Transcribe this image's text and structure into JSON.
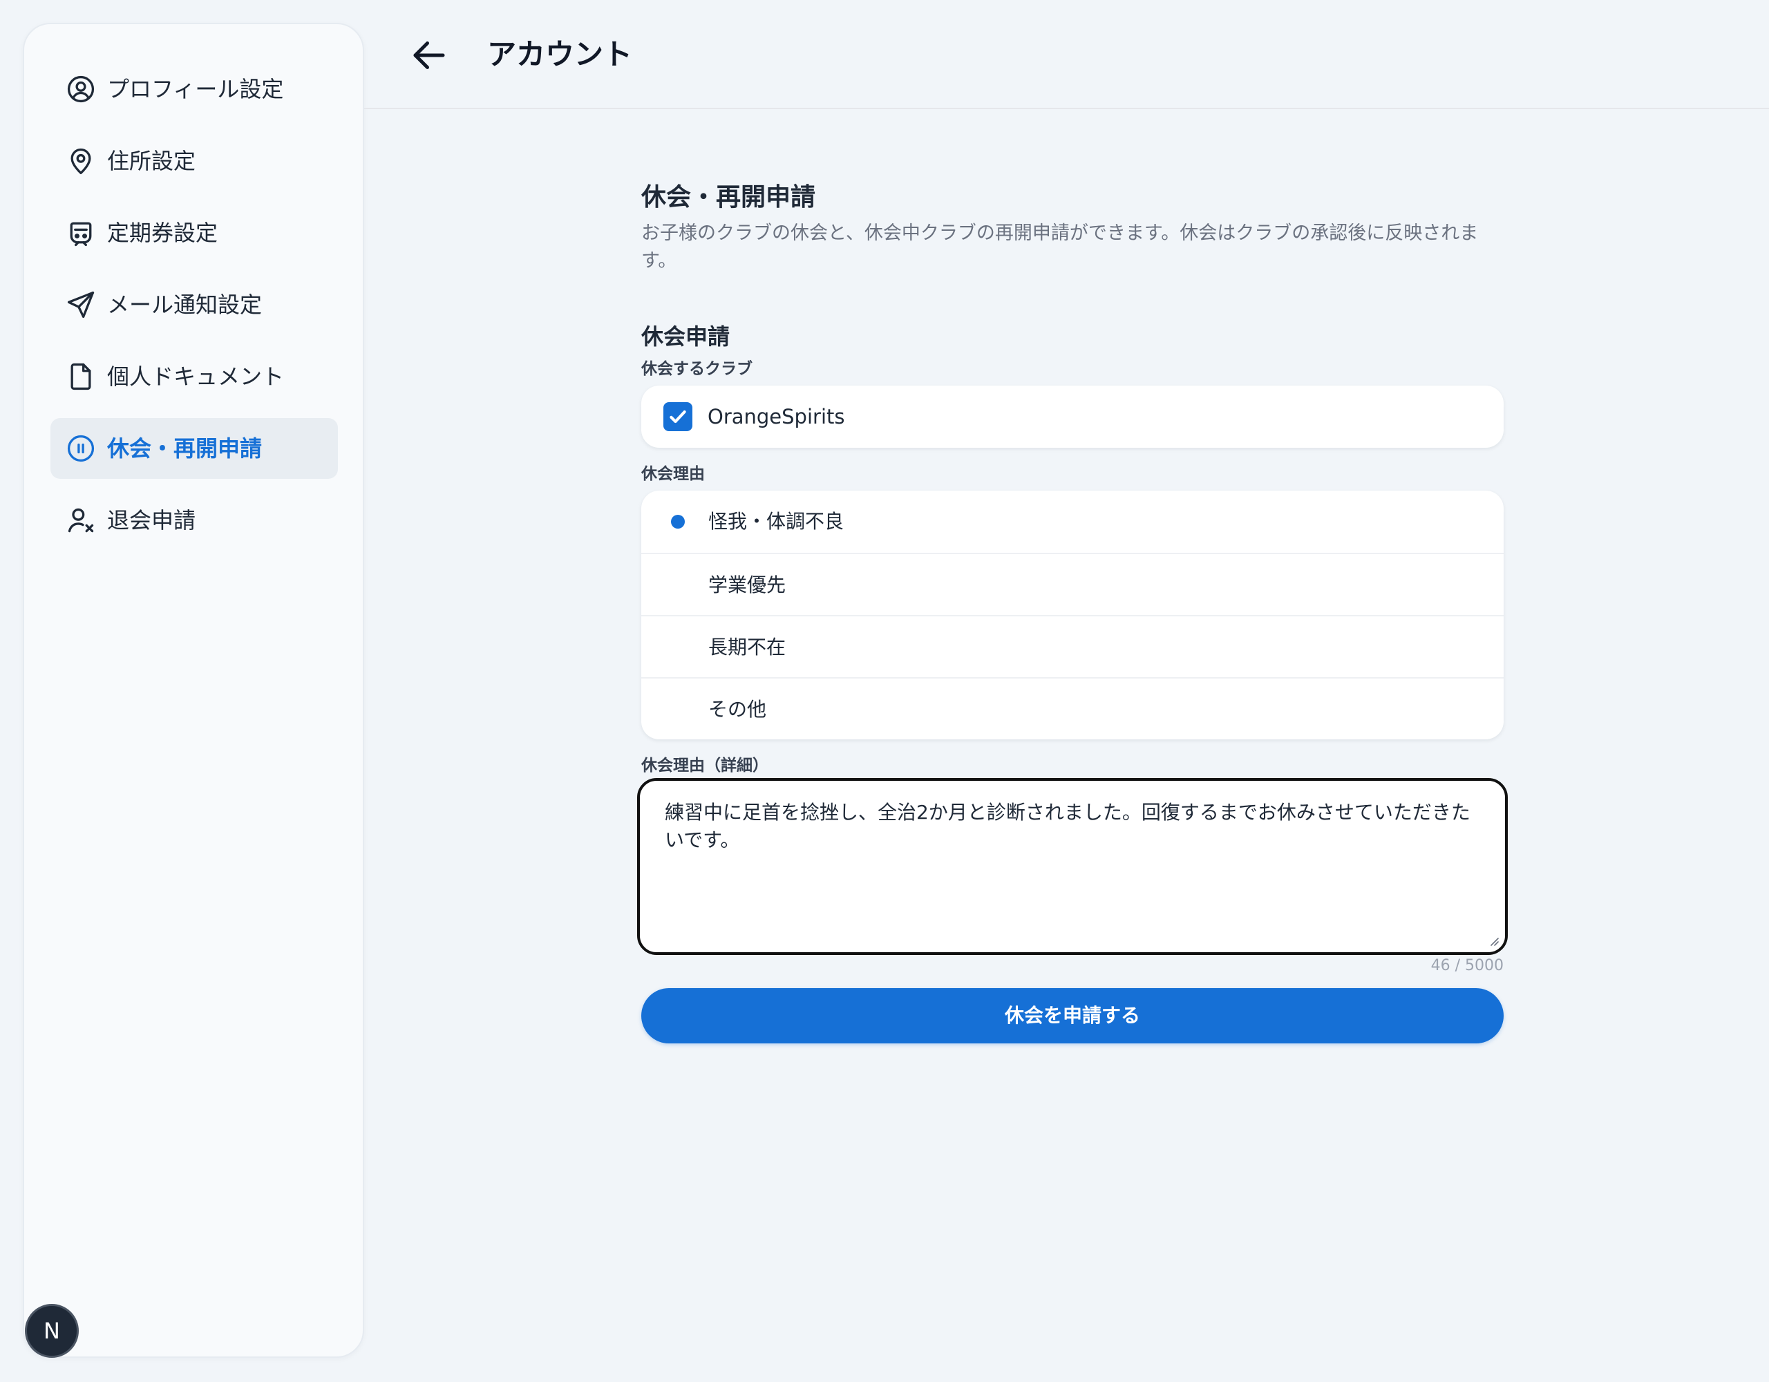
{
  "header": {
    "title": "アカウント",
    "back_icon": "arrow-left-icon"
  },
  "sidebar": {
    "items": [
      {
        "label": "プロフィール設定",
        "icon": "user-circle-icon",
        "active": false
      },
      {
        "label": "住所設定",
        "icon": "map-pin-icon",
        "active": false
      },
      {
        "label": "定期券設定",
        "icon": "commuter-pass-icon",
        "active": false
      },
      {
        "label": "メール通知設定",
        "icon": "send-icon",
        "active": false
      },
      {
        "label": "個人ドキュメント",
        "icon": "document-icon",
        "active": false
      },
      {
        "label": "休会・再開申請",
        "icon": "pause-circle-icon",
        "active": true
      },
      {
        "label": "退会申請",
        "icon": "user-x-icon",
        "active": false
      }
    ],
    "badge": "N"
  },
  "main": {
    "title": "休会・再開申請",
    "description": "お子様のクラブの休会と、休会中クラブの再開申請ができます。休会はクラブの承認後に反映されます。",
    "suspend": {
      "title": "休会申請",
      "club_label": "休会するクラブ",
      "clubs": [
        {
          "name": "OrangeSpirits",
          "checked": true
        }
      ],
      "reason_label": "休会理由",
      "reasons": [
        {
          "label": "怪我・体調不良",
          "selected": true
        },
        {
          "label": "学業優先",
          "selected": false
        },
        {
          "label": "長期不在",
          "selected": false
        },
        {
          "label": "その他",
          "selected": false
        }
      ],
      "detail_label": "休会理由（詳細）",
      "detail_value": "練習中に足首を捻挫し、全治2か月と診断されました。回復するまでお休みさせていただきたいです。",
      "char_count": "46 / 5000",
      "submit_label": "休会を申請する"
    }
  },
  "colors": {
    "accent": "#1670d6",
    "background": "#f1f5f9",
    "sidebar_bg": "#f8fafc",
    "active_item_bg": "#e8edf2"
  }
}
